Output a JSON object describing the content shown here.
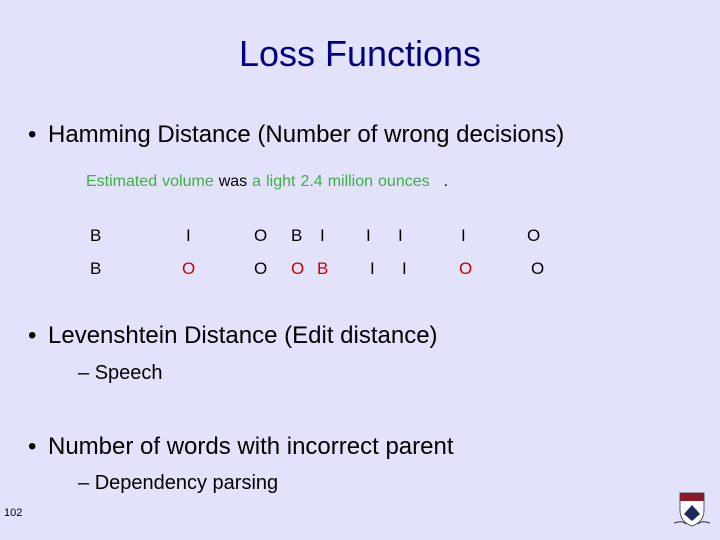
{
  "title": "Loss Functions",
  "bullets": [
    {
      "text": "Hamming Distance (Number of wrong decisions)"
    },
    {
      "text": "Levenshtein  Distance (Edit distance)",
      "sub": "Speech"
    },
    {
      "text": "Number of words with incorrect parent",
      "sub": "Dependency parsing"
    }
  ],
  "sentence": {
    "words": [
      "Estimated",
      "volume",
      "was",
      "a",
      "light",
      "2.4",
      "million",
      "ounces",
      "."
    ],
    "colors": [
      "#3cb043",
      "#3cb043",
      "#000000",
      "#3cb043",
      "#3cb043",
      "#3cb043",
      "#3cb043",
      "#3cb043",
      "#000000"
    ]
  },
  "gold_tags": [
    "B",
    "I",
    "O",
    "B",
    "I",
    "I",
    "I",
    "I",
    "O"
  ],
  "pred_tags": [
    "B",
    "O",
    "O",
    "O",
    "B",
    "I",
    "I",
    "O",
    "O"
  ],
  "pred_errors": [
    false,
    true,
    false,
    true,
    true,
    false,
    false,
    true,
    false
  ],
  "slide_number": "102",
  "logo": "penn-shield-icon",
  "colors": {
    "title": "#000080",
    "background": "#e2e2fa",
    "correct": "#3cb043",
    "error": "#cc0000"
  }
}
